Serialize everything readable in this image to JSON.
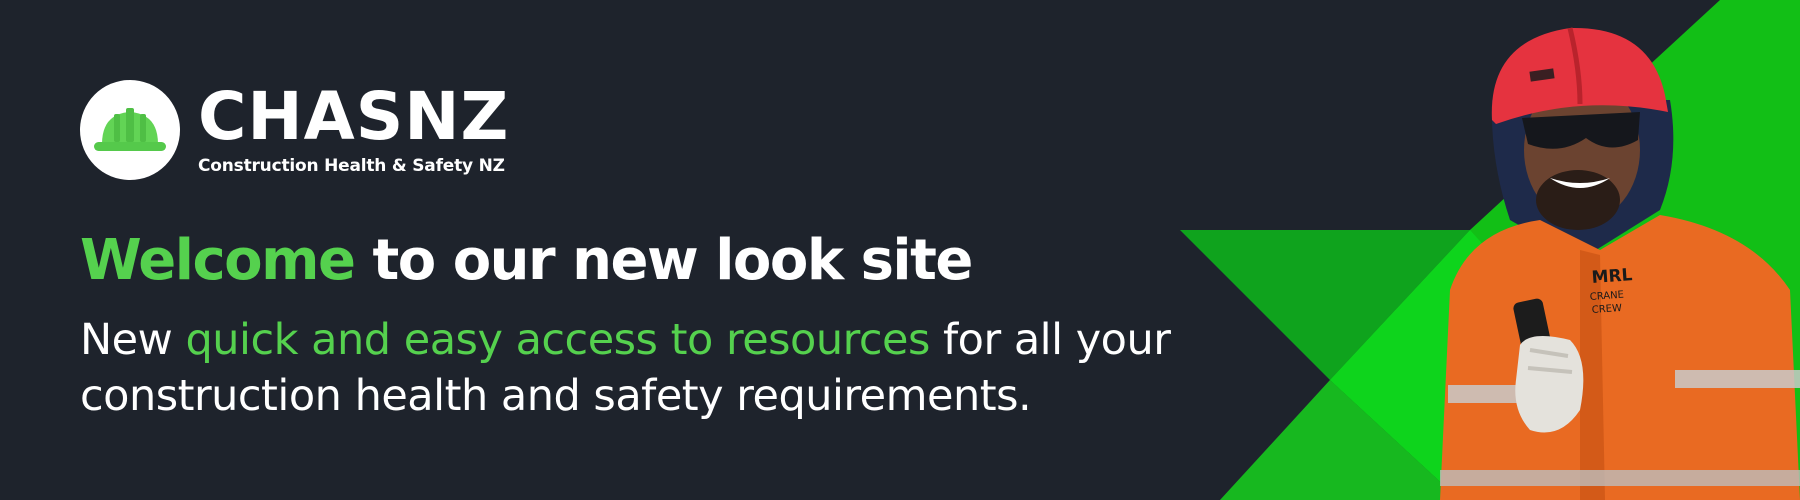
{
  "brand": {
    "name": "CHASNZ",
    "tagline": "Construction Health & Safety NZ",
    "logo_icon": "hard-hat-icon"
  },
  "headline": {
    "highlight": "Welcome",
    "rest": "to our new look site"
  },
  "subline": {
    "part1": "New",
    "highlight": "quick and easy access to resources",
    "part2": "for all your construction health and safety requirements."
  },
  "colors": {
    "background": "#1e232c",
    "accent_green": "#55d14e",
    "bright_green": "#15c91a",
    "text": "#ffffff"
  },
  "photo": {
    "subject": "construction-worker-photo",
    "shirt_text": "MRL CRANE CREW"
  }
}
